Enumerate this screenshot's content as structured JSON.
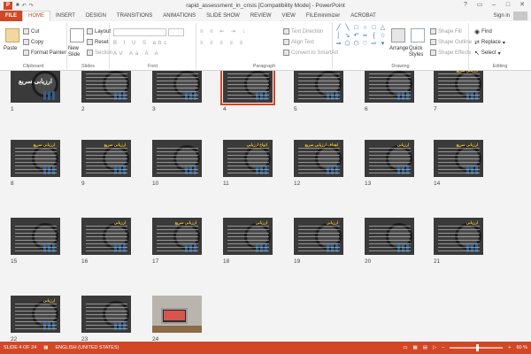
{
  "window": {
    "title": "rapid_assessment_in_crisis [Compatibility Mode] - PowerPoint",
    "controls": [
      "?",
      "▭",
      "–",
      "□",
      "✕"
    ]
  },
  "tabs": [
    "FILE",
    "HOME",
    "INSERT",
    "DESIGN",
    "TRANSITIONS",
    "ANIMATIONS",
    "SLIDE SHOW",
    "REVIEW",
    "VIEW",
    "FILEminimizer",
    "ACROBAT"
  ],
  "active_tab": "HOME",
  "account": {
    "sign_in": "Sign in"
  },
  "ribbon": {
    "clipboard": {
      "label": "Clipboard",
      "paste": "Paste",
      "cut": "Cut",
      "copy": "Copy",
      "format_painter": "Format Painter"
    },
    "slides": {
      "label": "Slides",
      "new_slide": "New Slide",
      "layout": "Layout",
      "reset": "Reset",
      "section": "Section"
    },
    "font": {
      "label": "Font"
    },
    "paragraph": {
      "label": "Paragraph",
      "text_direction": "Text Direction",
      "align_text": "Align Text",
      "convert_smartart": "Convert to SmartArt"
    },
    "drawing": {
      "label": "Drawing",
      "arrange": "Arrange",
      "quick_styles": "Quick Styles",
      "shape_fill": "Shape Fill",
      "shape_outline": "Shape Outline",
      "shape_effects": "Shape Effects"
    },
    "editing": {
      "label": "Editing",
      "find": "Find",
      "replace": "Replace",
      "select": "Select"
    }
  },
  "slides": [
    {
      "n": "1",
      "title": "ارزیابی سریع",
      "style": "title"
    },
    {
      "n": "2",
      "title": "",
      "style": "text"
    },
    {
      "n": "3",
      "title": "",
      "style": "text"
    },
    {
      "n": "4",
      "title": "",
      "style": "text",
      "selected": true
    },
    {
      "n": "5",
      "title": "",
      "style": "text"
    },
    {
      "n": "6",
      "title": "",
      "style": "text"
    },
    {
      "n": "7",
      "title": "ارزیابی سریع",
      "style": "text"
    },
    {
      "n": "8",
      "title": "ارزیابی سریع",
      "style": "text"
    },
    {
      "n": "9",
      "title": "ارزیابی سریع",
      "style": "text"
    },
    {
      "n": "10",
      "title": "",
      "style": "text"
    },
    {
      "n": "11",
      "title": "انواع ارزیابی",
      "style": "text"
    },
    {
      "n": "12",
      "title": "اهداف ارزیابی سریع",
      "style": "text"
    },
    {
      "n": "13",
      "title": "ارزیابی",
      "style": "text"
    },
    {
      "n": "14",
      "title": "ارزیابی سریع",
      "style": "text"
    },
    {
      "n": "15",
      "title": "",
      "style": "text"
    },
    {
      "n": "16",
      "title": "ارزیابی",
      "style": "text"
    },
    {
      "n": "17",
      "title": "ارزیابی سریع",
      "style": "text"
    },
    {
      "n": "18",
      "title": "ارزیابی",
      "style": "text"
    },
    {
      "n": "19",
      "title": "ارزیابی",
      "style": "text"
    },
    {
      "n": "20",
      "title": "",
      "style": "text"
    },
    {
      "n": "21",
      "title": "ارزیابی",
      "style": "text"
    },
    {
      "n": "22",
      "title": "ارزیابی",
      "style": "text"
    },
    {
      "n": "23",
      "title": "",
      "style": "text"
    },
    {
      "n": "24",
      "title": "",
      "style": "photo"
    }
  ],
  "status": {
    "slide": "SLIDE 4 OF 24",
    "language": "ENGLISH (UNITED STATES)",
    "zoom": "60 %",
    "zoom_fraction": 0.6
  }
}
